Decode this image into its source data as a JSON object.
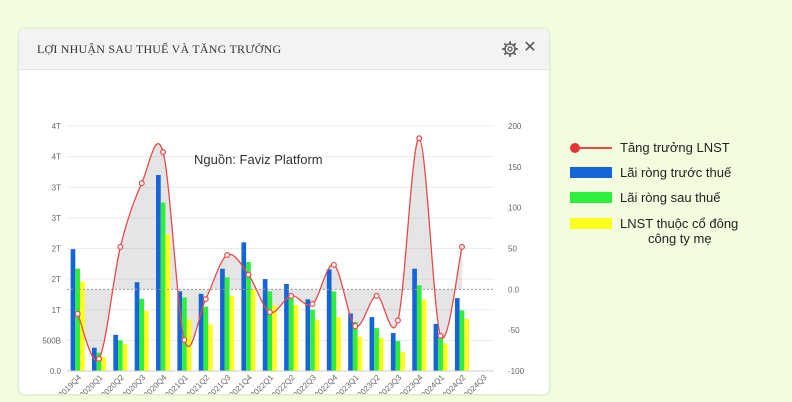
{
  "panel": {
    "title": "LỢI NHUẬN SAU THUẾ VÀ TĂNG TRƯỞNG",
    "settings_icon": "gear-icon",
    "close_label": "✕"
  },
  "chart_data": {
    "type": "bar",
    "watermark": "Nguồn: Faviz Platform",
    "categories": [
      "2019Q4",
      "2020Q1",
      "2020Q2",
      "2020Q3",
      "2020Q4",
      "2021Q1",
      "2021Q2",
      "2021Q3",
      "2021Q4",
      "2022Q1",
      "2022Q2",
      "2022Q3",
      "2022Q4",
      "2023Q1",
      "2023Q2",
      "2023Q3",
      "2023Q4",
      "2024Q1",
      "2024Q2",
      "2024Q3"
    ],
    "left_axis": {
      "ticks": [
        "0.0",
        "500B",
        "1T",
        "2T",
        "2T",
        "3T",
        "3T",
        "4T",
        "4T"
      ],
      "ylim": [
        0,
        4000
      ]
    },
    "right_axis": {
      "ticks": [
        "-100",
        "-50",
        "0.0",
        "50",
        "100",
        "150",
        "200"
      ],
      "ylim": [
        -100,
        200
      ]
    },
    "series": [
      {
        "name": "Lãi ròng trước thuế",
        "color": "#1565d8",
        "values": [
          1990,
          380,
          590,
          1450,
          3200,
          1300,
          1260,
          1670,
          2100,
          1500,
          1420,
          1170,
          1660,
          940,
          880,
          620,
          1670,
          770,
          1190,
          null
        ]
      },
      {
        "name": "Lãi ròng sau thuế",
        "color": "#2ef03c",
        "values": [
          1670,
          300,
          500,
          1180,
          2750,
          1200,
          1050,
          1530,
          1780,
          1300,
          1230,
          1000,
          1300,
          800,
          700,
          490,
          1400,
          600,
          990,
          null
        ]
      },
      {
        "name": "LNST thuộc cổ đông công ty mẹ",
        "color": "#ffff1e",
        "values": [
          1460,
          230,
          440,
          980,
          2220,
          840,
          760,
          1230,
          1330,
          1070,
          1080,
          830,
          880,
          560,
          540,
          310,
          1170,
          450,
          850,
          null
        ]
      },
      {
        "name": "Tăng trưởng LNST",
        "type": "line",
        "axis": "right",
        "color": "#e84a4a",
        "values": [
          -30,
          -85,
          52,
          130,
          168,
          -62,
          -12,
          42,
          18,
          -28,
          -8,
          -18,
          30,
          -45,
          -8,
          -38,
          185,
          -57,
          52,
          null
        ]
      }
    ],
    "legend": {
      "position": "right"
    },
    "grid": true
  }
}
